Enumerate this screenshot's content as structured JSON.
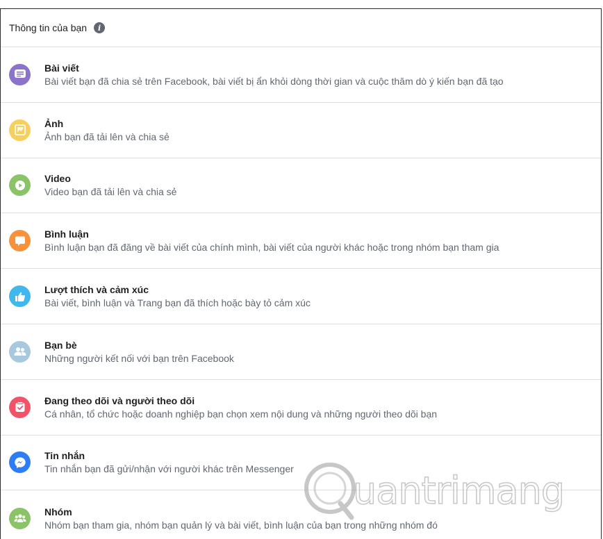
{
  "header": {
    "title": "Thông tin của bạn",
    "info_icon": "info-icon"
  },
  "items": [
    {
      "title": "Bài viết",
      "desc": "Bài viết bạn đã chia sẻ trên Facebook, bài viết bị ẩn khỏi dòng thời gian và cuộc thăm dò ý kiến bạn đã tạo",
      "icon": "posts-icon",
      "color": "#8c72cb"
    },
    {
      "title": "Ảnh",
      "desc": "Ảnh bạn đã tải lên và chia sẻ",
      "icon": "photos-icon",
      "color": "#f7cf5d"
    },
    {
      "title": "Video",
      "desc": "Video bạn đã tải lên và chia sẻ",
      "icon": "video-icon",
      "color": "#8ac466"
    },
    {
      "title": "Bình luận",
      "desc": "Bình luận bạn đã đăng về bài viết của chính mình, bài viết của người khác hoặc trong nhóm bạn tham gia",
      "icon": "comments-icon",
      "color": "#f7923a"
    },
    {
      "title": "Lượt thích và cảm xúc",
      "desc": "Bài viết, bình luận và Trang bạn đã thích hoặc bày tỏ cảm xúc",
      "icon": "likes-icon",
      "color": "#3fb8ee"
    },
    {
      "title": "Bạn bè",
      "desc": "Những người kết nối với bạn trên Facebook",
      "icon": "friends-icon",
      "color": "#a8c8e0"
    },
    {
      "title": "Đang theo dõi và người theo dõi",
      "desc": "Cá nhân, tổ chức hoặc doanh nghiệp bạn chọn xem nội dung và những người theo dõi bạn",
      "icon": "following-icon",
      "color": "#f35369"
    },
    {
      "title": "Tin nhắn",
      "desc": "Tin nhắn bạn đã gửi/nhận với người khác trên Messenger",
      "icon": "messenger-icon",
      "color": "#2e7cf6"
    },
    {
      "title": "Nhóm",
      "desc": "Nhóm bạn tham gia, nhóm bạn quản lý và bài viết, bình luận của bạn trong những nhóm đó",
      "icon": "groups-icon",
      "color": "#8ac466"
    }
  ],
  "watermark": "uantrimang"
}
